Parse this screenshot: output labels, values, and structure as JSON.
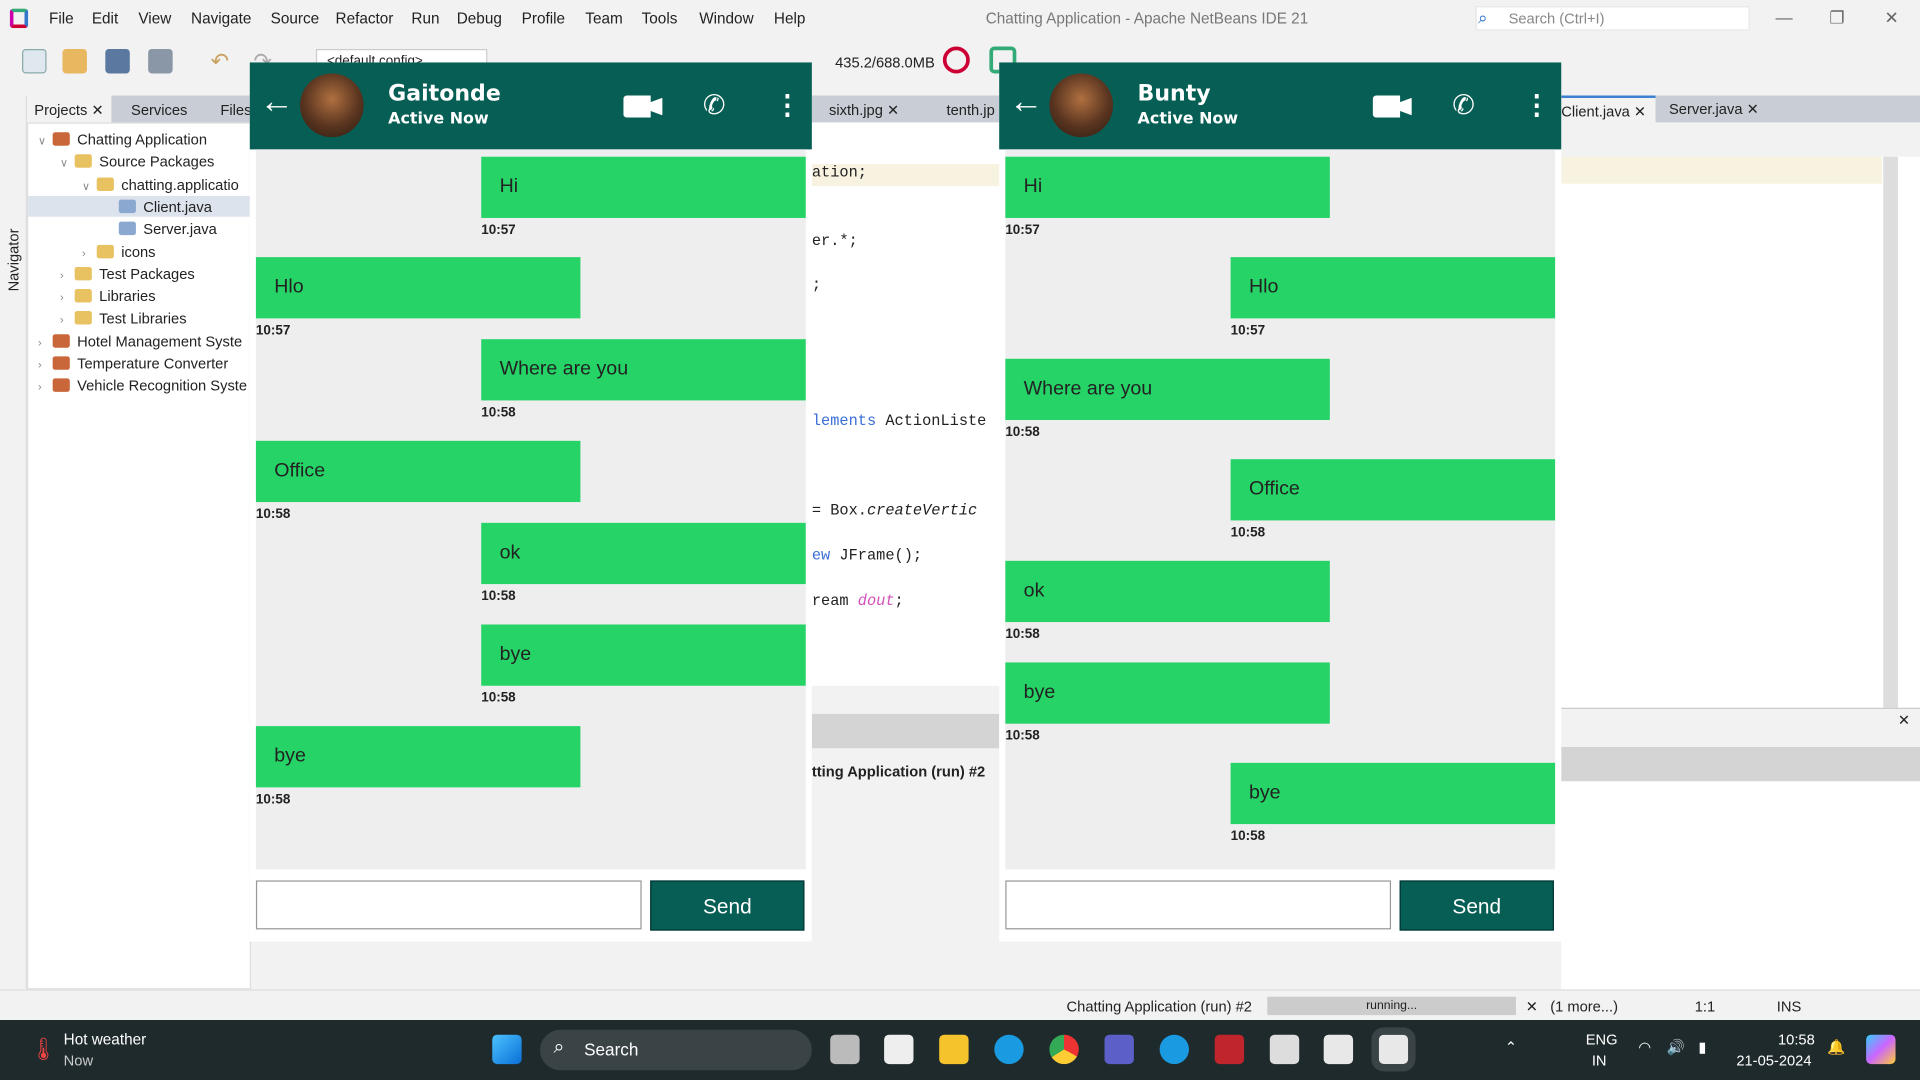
{
  "window": {
    "title": "Chatting Application - Apache NetBeans IDE 21",
    "search_placeholder": "Search (Ctrl+I)"
  },
  "menu": [
    "File",
    "Edit",
    "View",
    "Navigate",
    "Source",
    "Refactor",
    "Run",
    "Debug",
    "Profile",
    "Team",
    "Tools",
    "Window",
    "Help"
  ],
  "toolbar": {
    "config": "<default config>",
    "memory": "435.2/688.0MB"
  },
  "left_tabs": {
    "projects": "Projects",
    "services": "Services",
    "files": "Files",
    "navigator": "Navigator"
  },
  "tree": [
    {
      "label": "Chatting Application",
      "level": 0
    },
    {
      "label": "Source Packages",
      "level": 1
    },
    {
      "label": "chatting.applicatio",
      "level": 2
    },
    {
      "label": "Client.java",
      "level": 3,
      "selected": true
    },
    {
      "label": "Server.java",
      "level": 3
    },
    {
      "label": "icons",
      "level": 2
    },
    {
      "label": "Test Packages",
      "level": 1
    },
    {
      "label": "Libraries",
      "level": 1
    },
    {
      "label": "Test Libraries",
      "level": 1
    },
    {
      "label": "Hotel Management Syste",
      "level": 0
    },
    {
      "label": "Temperature Converter",
      "level": 0
    },
    {
      "label": "Vehicle Recognition Syste",
      "level": 0
    }
  ],
  "editor_tabs": {
    "sixth": "sixth.jpg",
    "tenth": "tenth.jp",
    "client": "Client.java",
    "server": "Server.java"
  },
  "code": {
    "l1": "ation;",
    "l2": "er.*;",
    "l3": ";",
    "l4a": "lements",
    "l4b": " ActionListe",
    "l5a": " = Box.",
    "l5b": "createVertic",
    "l6a": "ew",
    "l6b": " JFrame();",
    "l7a": "ream ",
    "l7b": "dout",
    "l7c": ";",
    "output": "tting Application (run) #2"
  },
  "chats": [
    {
      "name": "Gaitonde",
      "status": "Active Now",
      "send": "Send",
      "input_value": "",
      "messages": [
        {
          "text": "Hi",
          "time": "10:57",
          "side": "right"
        },
        {
          "text": "Hlo",
          "time": "10:57",
          "side": "left"
        },
        {
          "text": "Where are you",
          "time": "10:58",
          "side": "right"
        },
        {
          "text": "Office",
          "time": "10:58",
          "side": "left"
        },
        {
          "text": "ok",
          "time": "10:58",
          "side": "right"
        },
        {
          "text": "bye",
          "time": "10:58",
          "side": "right"
        },
        {
          "text": "bye",
          "time": "10:58",
          "side": "left"
        }
      ]
    },
    {
      "name": "Bunty",
      "status": "Active Now",
      "send": "Send",
      "input_value": "",
      "messages": [
        {
          "text": "Hi",
          "time": "10:57",
          "side": "left"
        },
        {
          "text": "Hlo",
          "time": "10:57",
          "side": "right"
        },
        {
          "text": "Where are you",
          "time": "10:58",
          "side": "left"
        },
        {
          "text": "Office",
          "time": "10:58",
          "side": "right"
        },
        {
          "text": "ok",
          "time": "10:58",
          "side": "left"
        },
        {
          "text": "bye",
          "time": "10:58",
          "side": "left"
        },
        {
          "text": "bye",
          "time": "10:58",
          "side": "right"
        }
      ]
    }
  ],
  "statusbar": {
    "task": "Chatting Application (run) #2",
    "progress": "running...",
    "more": "(1 more...)",
    "position": "1:1",
    "mode": "INS"
  },
  "taskbar": {
    "weather_title": "Hot weather",
    "weather_sub": "Now",
    "search": "Search",
    "lang1": "ENG",
    "lang2": "IN",
    "time": "10:58",
    "date": "21-05-2024"
  },
  "colors": {
    "header": "#075e55",
    "bubble": "#25d366"
  }
}
